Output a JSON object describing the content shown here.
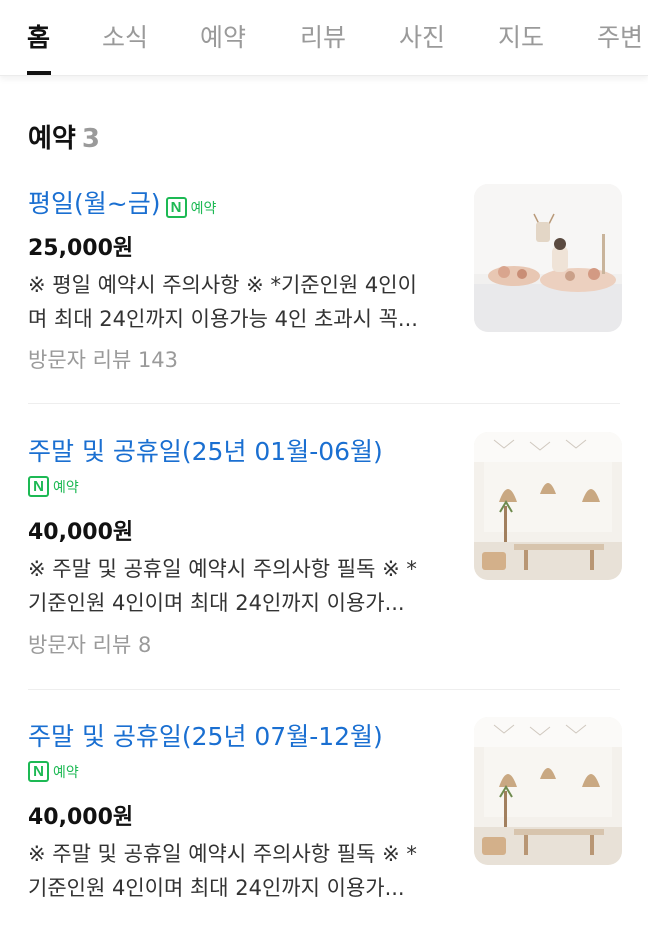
{
  "tabs": [
    {
      "label": "홈",
      "active": true
    },
    {
      "label": "소식"
    },
    {
      "label": "예약"
    },
    {
      "label": "리뷰"
    },
    {
      "label": "사진"
    },
    {
      "label": "지도"
    },
    {
      "label": "주변"
    }
  ],
  "section": {
    "title": "예약",
    "count": "3"
  },
  "items": [
    {
      "name": "평일(월~금)",
      "badge": "예약",
      "price": "25,000원",
      "desc_line1": "※ 평일 예약시 주의사항 ※ *기준인원 4인이",
      "desc_line2": "며 최대 24인까지 이용가능 4인 초과시 꼭...",
      "review": "방문자 리뷰 143"
    },
    {
      "name": "주말 및 공휴일(25년 01월-06월)",
      "badge": "예약",
      "price": "40,000원",
      "desc_line1": "※ 주말 및 공휴일 예약시 주의사항 필독 ※ *",
      "desc_line2": "기준인원 4인이며 최대 24인까지 이용가...",
      "review": "방문자 리뷰 8"
    },
    {
      "name": "주말 및 공휴일(25년 07월-12월)",
      "badge": "예약",
      "price": "40,000원",
      "desc_line1": "※ 주말 및 공휴일 예약시 주의사항 필독 ※ *",
      "desc_line2": "기준인원 4인이며 최대 24인까지 이용가..."
    }
  ],
  "colors": {
    "link": "#1a6fd1",
    "badge": "#1db954",
    "muted": "#9a9a9a"
  }
}
